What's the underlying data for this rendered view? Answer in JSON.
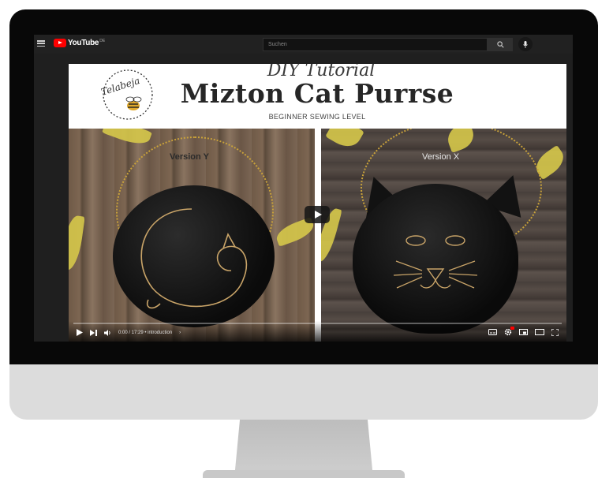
{
  "header": {
    "logo_text": "YouTube",
    "country_code": "DE",
    "search_placeholder": "Suchen"
  },
  "thumbnail": {
    "brand": "Telabeja",
    "overline": "DIY Tutorial",
    "title": "Mizton Cat Purrse",
    "subtitle": "BEGINNER SEWING LEVEL",
    "left_label": "Version Y",
    "right_label": "Version X"
  },
  "player": {
    "time": "0:00 / 17:29 • introduction",
    "chapter_chevron": "›",
    "progress": 0.0
  },
  "colors": {
    "brand_red": "#ff0000",
    "header_bg": "#212121",
    "bezel": "#080808"
  }
}
